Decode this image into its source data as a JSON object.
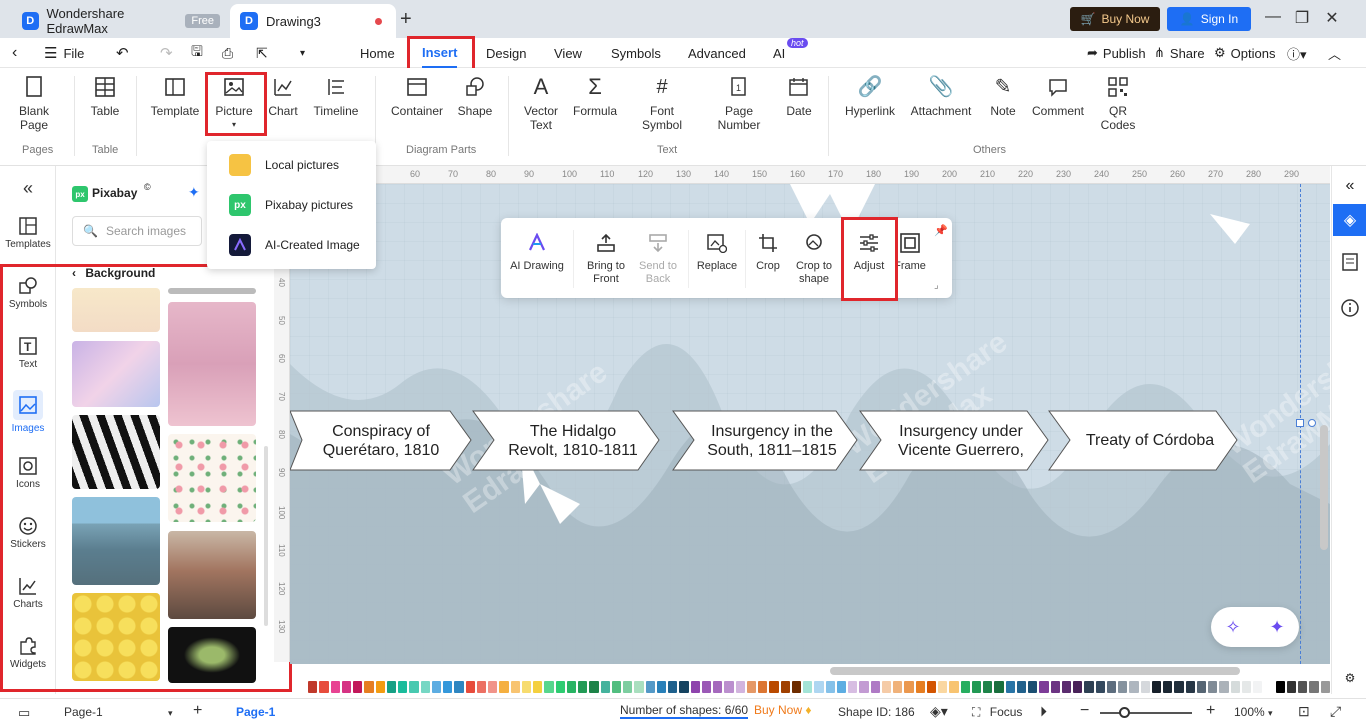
{
  "titlebar": {
    "app_name": "Wondershare EdrawMax",
    "app_badge": "Free",
    "doc_name": "Drawing3",
    "buy_now": "Buy Now",
    "sign_in": "Sign In"
  },
  "menu": {
    "file": "File",
    "tabs": [
      "Home",
      "Insert",
      "Design",
      "View",
      "Symbols",
      "Advanced",
      "AI"
    ],
    "hot": "hot",
    "publish": "Publish",
    "share": "Share",
    "options": "Options"
  },
  "ribbon": {
    "blank_page": "Blank\nPage",
    "table": "Table",
    "template": "Template",
    "picture": "Picture",
    "chart": "Chart",
    "timeline": "Timeline",
    "container": "Container",
    "shape": "Shape",
    "vector_text": "Vector\nText",
    "formula": "Formula",
    "font_symbol": "Font\nSymbol",
    "page_number": "Page\nNumber",
    "date": "Date",
    "hyperlink": "Hyperlink",
    "attachment": "Attachment",
    "note": "Note",
    "comment": "Comment",
    "qr_codes": "QR\nCodes",
    "groups": {
      "pages": "Pages",
      "table": "Table",
      "diagram_parts": "Diagram Parts",
      "text": "Text",
      "others": "Others"
    }
  },
  "picture_menu": {
    "local": "Local pictures",
    "pixabay": "Pixabay pictures",
    "ai": "AI-Created Image"
  },
  "leftbar": {
    "templates": "Templates",
    "symbols": "Symbols",
    "text": "Text",
    "images": "Images",
    "icons": "Icons",
    "stickers": "Stickers",
    "charts": "Charts",
    "widgets": "Widgets"
  },
  "library": {
    "title": "Pixabay",
    "search_placeholder": "Search images",
    "category": "Background"
  },
  "floatbar": {
    "ai_drawing": "AI Drawing",
    "bring_to_front": "Bring to\nFront",
    "send_to_back": "Send to\nBack",
    "replace": "Replace",
    "crop": "Crop",
    "crop_to_shape": "Crop to\nshape",
    "adjust": "Adjust",
    "frame": "Frame"
  },
  "timeline": [
    "Conspiracy of\nQuerétaro, 1810",
    "The Hidalgo\nRevolt, 1810-1811",
    "Insurgency in the\nSouth, 1811–1815",
    "Insurgency under\nVicente Guerrero,",
    "Treaty of Córdoba"
  ],
  "watermark": "Wondershare\nEdrawMax",
  "ruler": {
    "h": [
      "60",
      "70",
      "80",
      "90",
      "100",
      "110",
      "120",
      "130",
      "140",
      "150",
      "160",
      "170",
      "180",
      "190",
      "200",
      "210",
      "220",
      "230",
      "240",
      "250",
      "260",
      "270",
      "280",
      "290"
    ],
    "v": [
      "40",
      "50",
      "60",
      "70",
      "80",
      "90",
      "100",
      "110",
      "120",
      "130"
    ]
  },
  "status": {
    "page_selector": "Page-1",
    "page_tab": "Page-1",
    "shapes": "Number of shapes: 6/60",
    "buy_now": "Buy Now",
    "shape_id": "Shape ID: 186",
    "focus": "Focus",
    "zoom": "100%"
  },
  "colors": {
    "accent": "#1e6ef4",
    "highlight": "#e0262c",
    "canvas": "#ccdae4",
    "swatches": [
      "#c0392b",
      "#e74c3c",
      "#e84393",
      "#d63384",
      "#c2185b",
      "#e67e22",
      "#f39c12",
      "#16a085",
      "#1abc9c",
      "#48c9b0",
      "#76d7c4",
      "#5dade2",
      "#3498db",
      "#2e86c1",
      "#e74c3c",
      "#ec7063",
      "#f1948a",
      "#f5b041",
      "#f8c471",
      "#f7dc6f",
      "#f4d03f",
      "#58d68d",
      "#2ecc71",
      "#28b463",
      "#239b56",
      "#1d8348",
      "#45b39d",
      "#52be80",
      "#7dcea0",
      "#a9dfbf",
      "#5499c7",
      "#2980b9",
      "#1f618d",
      "#154360",
      "#8e44ad",
      "#9b59b6",
      "#a569bd",
      "#bb8fce",
      "#d2b4de",
      "#e59866",
      "#dc7633",
      "#ba4a00",
      "#a04000",
      "#6e2c00",
      "#a3e4d7",
      "#aed6f1",
      "#85c1e9",
      "#5dade2",
      "#d7bde2",
      "#c39bd3",
      "#af7ac5",
      "#f5cba7",
      "#f0b27a",
      "#eb984e",
      "#e67e22",
      "#d35400",
      "#fad7a0",
      "#f8c471",
      "#27ae60",
      "#229954",
      "#1e8449",
      "#196f3d",
      "#2874a6",
      "#21618c",
      "#1b4f72",
      "#7d3c98",
      "#6c3483",
      "#5b2c6f",
      "#4a235a",
      "#2e4053",
      "#34495e",
      "#5d6d7e",
      "#85929e",
      "#aeb6bf",
      "#d5d8dc",
      "#17202a",
      "#1c2833",
      "#212f3c",
      "#273746",
      "#566573",
      "#808b96",
      "#abb2b9",
      "#d5dbdb",
      "#e5e8e8",
      "#f2f3f4",
      "#ffffff",
      "#000000",
      "#333333",
      "#555555",
      "#777777",
      "#999999"
    ]
  }
}
